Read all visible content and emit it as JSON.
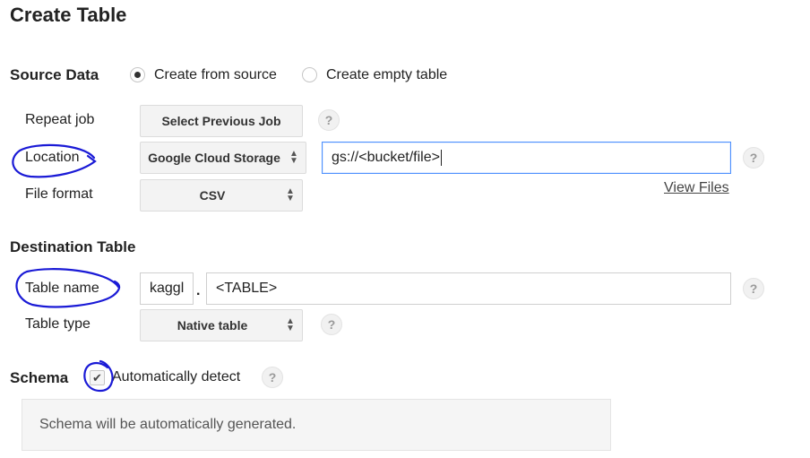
{
  "page": {
    "title": "Create Table"
  },
  "source_data": {
    "title": "Source Data",
    "radio_options": [
      "Create from source",
      "Create empty table"
    ],
    "selected_option": "Create from source",
    "repeat_job": {
      "label": "Repeat job",
      "button": "Select Previous Job",
      "help": "?"
    },
    "location": {
      "label": "Location",
      "select_value": "Google Cloud Storage",
      "input_value": "gs://<bucket/file>",
      "help": "?"
    },
    "file_format": {
      "label": "File format",
      "select_value": "CSV",
      "view_files": "View Files"
    }
  },
  "destination_table": {
    "title": "Destination Table",
    "table_name": {
      "label": "Table name",
      "dataset_value": "kaggl",
      "separator": ".",
      "table_value": "<TABLE>",
      "help": "?"
    },
    "table_type": {
      "label": "Table type",
      "select_value": "Native table",
      "help": "?"
    }
  },
  "schema": {
    "title": "Schema",
    "auto_detect_label": "Automatically detect",
    "auto_detect_checked": true,
    "help": "?",
    "message": "Schema will be automatically generated."
  },
  "colors": {
    "annotation": "#1a1ad6",
    "focus_border": "#4d90fe",
    "button_bg": "#f3f3f3"
  }
}
